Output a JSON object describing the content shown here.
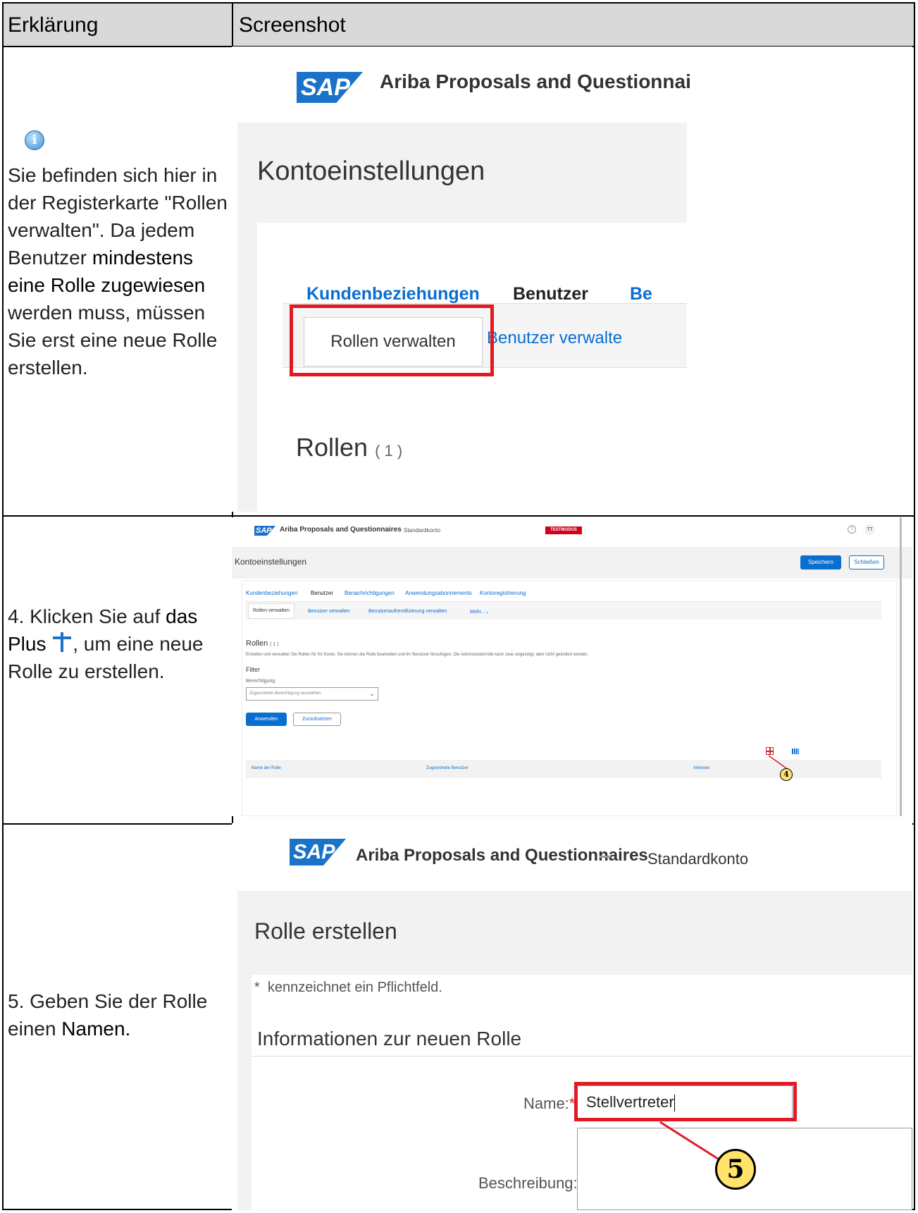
{
  "header": {
    "col1": "Erklärung",
    "col2": "Screenshot"
  },
  "row1": {
    "info_icon": "info-icon",
    "text_a": "Sie befinden sich hier in der Registerkarte \"Rollen verwalten\". Da jedem Benutzer ",
    "text_bold": "mindestens eine Rolle zugewiesen",
    "text_b": " werden muss, müssen Sie erst eine neue Rolle erstellen.",
    "shot": {
      "logo": "SAP",
      "app_title": "Ariba Proposals and Questionnai",
      "page_title": "Kontoeinstellungen",
      "tab_customers": "Kundenbeziehungen",
      "tab_users": "Benutzer",
      "tab_more": "Be",
      "subtab_roles": "Rollen verwalten",
      "subtab_users": "Benutzer verwalte",
      "roles_heading": "Rollen",
      "roles_count": "( 1 )"
    }
  },
  "row2": {
    "text_a": "4. Klicken Sie auf ",
    "text_bold1": "das Plus",
    "text_b": ", um eine neue Rolle zu erstellen.",
    "shot": {
      "logo": "SAP",
      "app_title": "Ariba Proposals and Questionnaires",
      "account": "Standardkonto",
      "mode_badge": "TESTMODUS",
      "help": "?",
      "avatar": "TT",
      "page_title": "Kontoeinstellungen",
      "save": "Speichern",
      "close": "Schließen",
      "tabs": [
        "Kundenbeziehungen",
        "Benutzer",
        "Benachrichtigungen",
        "Anwendungsabonnements",
        "Kontoregistrierung"
      ],
      "subtabs": [
        "Rollen verwalten",
        "Benutzer verwalten",
        "Benutzerauthentifizierung verwalten",
        "Mehr...⌄"
      ],
      "roles_heading": "Rollen",
      "roles_count": "( 1 )",
      "roles_desc": "Erstellen und verwalten Sie Rollen für Ihr Konto. Sie können die Rolle bearbeiten und ihr Benutzer hinzufügen. Die Administratorrolle kann zwar angezeigt, aber nicht geändert werden.",
      "filter": "Filter",
      "permission_label": "Berechtigung",
      "permission_placeholder": "Zugeordnete Berechtigung auswählen",
      "apply": "Anwenden",
      "reset": "Zurücksetzen",
      "col_name": "Name der Rolle",
      "col_users": "Zugeordnete Benutzer",
      "col_actions": "Aktionen",
      "callout": "4"
    }
  },
  "row3": {
    "text_a": "5. Geben Sie der Rolle einen ",
    "text_bold": "Namen.",
    "shot": {
      "logo": "SAP",
      "app_title": "Ariba Proposals and Questionnaires",
      "account": "Standardkonto",
      "page_title": "Rolle erstellen",
      "required_note": "kennzeichnet ein Pflichtfeld.",
      "required_star": "*",
      "section_title": "Informationen zur neuen Rolle",
      "name_label": "Name:",
      "name_value": "Stellvertreter",
      "desc_label": "Beschreibung:",
      "callout": "5"
    }
  },
  "colors": {
    "sap_blue": "#1a73c9",
    "link_blue": "#0a6ed1",
    "highlight_red": "#e01b24",
    "callout_yellow": "#ffe36b"
  }
}
